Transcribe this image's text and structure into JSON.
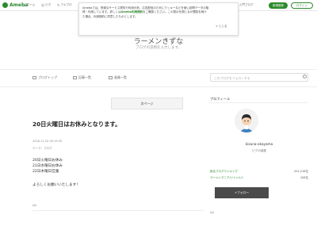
{
  "header": {
    "logo_text": "Ameba",
    "nav": [
      {
        "label": "ホーム"
      },
      {
        "label": "ピグ"
      },
      {
        "label": "アメブロ"
      }
    ],
    "help_label": "入門ブログ",
    "signup_label": "新規登録",
    "login_label": "ログイン"
  },
  "notice": {
    "text_1": "Amebaでは、快適なサービス提供や利用分析、広告配信のためにクッキーなどを使い訪問データの取",
    "text_2": "得・利用しています。詳しくは",
    "link": "Ameba利用規約",
    "text_3": "をご確認ください。この表示を閉じるか閲覧を続け",
    "text_4": "た場合、利用規約に同意したものとします。",
    "close_label": "とじる"
  },
  "blog": {
    "title": "ラーメンきずな",
    "description": "ブログの説明を入力します。"
  },
  "tabs": [
    {
      "label": "ブログトップ"
    },
    {
      "label": "記事一覧"
    },
    {
      "label": "画像一覧"
    }
  ],
  "search": {
    "placeholder": "このブログをフォローする"
  },
  "article": {
    "next_label": "次ページ",
    "title": "20日火曜日はお休みとなります。",
    "date": "2018-11-20 05:19:35",
    "theme": "テーマ：ブログ",
    "lines": [
      "20日火曜日お休み",
      "21日水曜日お休み",
      "22日木曜日営業"
    ],
    "closing": "よろしくお願いいたします！",
    "ad_label": "AD"
  },
  "sidebar": {
    "profile_title": "プロフィール",
    "name": "kizuna-okayama",
    "links": "ピグの部屋",
    "ranks": [
      {
        "label": "総合ブログランキング",
        "value": "201,218位"
      },
      {
        "label": "ラーメンマニア/ジャンル1",
        "value": "106位"
      }
    ],
    "follow_label": "+フォロー",
    "ad_label": "AD"
  },
  "colors": {
    "brand": "#2d8a2d",
    "follow_bg": "#4a4a4a"
  }
}
